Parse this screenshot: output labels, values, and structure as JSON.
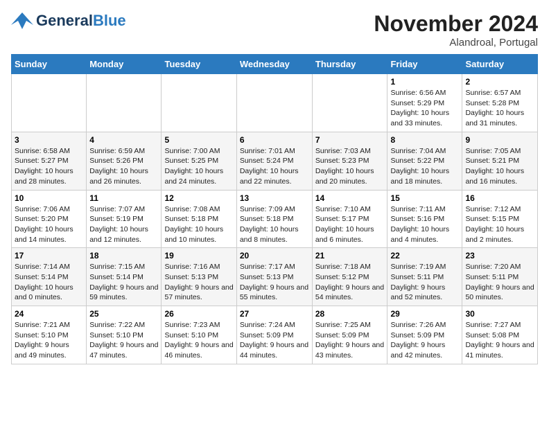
{
  "header": {
    "logo_general": "General",
    "logo_blue": "Blue",
    "month_title": "November 2024",
    "location": "Alandroal, Portugal"
  },
  "days_of_week": [
    "Sunday",
    "Monday",
    "Tuesday",
    "Wednesday",
    "Thursday",
    "Friday",
    "Saturday"
  ],
  "weeks": [
    [
      {
        "day": "",
        "sunrise": "",
        "sunset": "",
        "daylight": ""
      },
      {
        "day": "",
        "sunrise": "",
        "sunset": "",
        "daylight": ""
      },
      {
        "day": "",
        "sunrise": "",
        "sunset": "",
        "daylight": ""
      },
      {
        "day": "",
        "sunrise": "",
        "sunset": "",
        "daylight": ""
      },
      {
        "day": "",
        "sunrise": "",
        "sunset": "",
        "daylight": ""
      },
      {
        "day": "1",
        "sunrise": "Sunrise: 6:56 AM",
        "sunset": "Sunset: 5:29 PM",
        "daylight": "Daylight: 10 hours and 33 minutes."
      },
      {
        "day": "2",
        "sunrise": "Sunrise: 6:57 AM",
        "sunset": "Sunset: 5:28 PM",
        "daylight": "Daylight: 10 hours and 31 minutes."
      }
    ],
    [
      {
        "day": "3",
        "sunrise": "Sunrise: 6:58 AM",
        "sunset": "Sunset: 5:27 PM",
        "daylight": "Daylight: 10 hours and 28 minutes."
      },
      {
        "day": "4",
        "sunrise": "Sunrise: 6:59 AM",
        "sunset": "Sunset: 5:26 PM",
        "daylight": "Daylight: 10 hours and 26 minutes."
      },
      {
        "day": "5",
        "sunrise": "Sunrise: 7:00 AM",
        "sunset": "Sunset: 5:25 PM",
        "daylight": "Daylight: 10 hours and 24 minutes."
      },
      {
        "day": "6",
        "sunrise": "Sunrise: 7:01 AM",
        "sunset": "Sunset: 5:24 PM",
        "daylight": "Daylight: 10 hours and 22 minutes."
      },
      {
        "day": "7",
        "sunrise": "Sunrise: 7:03 AM",
        "sunset": "Sunset: 5:23 PM",
        "daylight": "Daylight: 10 hours and 20 minutes."
      },
      {
        "day": "8",
        "sunrise": "Sunrise: 7:04 AM",
        "sunset": "Sunset: 5:22 PM",
        "daylight": "Daylight: 10 hours and 18 minutes."
      },
      {
        "day": "9",
        "sunrise": "Sunrise: 7:05 AM",
        "sunset": "Sunset: 5:21 PM",
        "daylight": "Daylight: 10 hours and 16 minutes."
      }
    ],
    [
      {
        "day": "10",
        "sunrise": "Sunrise: 7:06 AM",
        "sunset": "Sunset: 5:20 PM",
        "daylight": "Daylight: 10 hours and 14 minutes."
      },
      {
        "day": "11",
        "sunrise": "Sunrise: 7:07 AM",
        "sunset": "Sunset: 5:19 PM",
        "daylight": "Daylight: 10 hours and 12 minutes."
      },
      {
        "day": "12",
        "sunrise": "Sunrise: 7:08 AM",
        "sunset": "Sunset: 5:18 PM",
        "daylight": "Daylight: 10 hours and 10 minutes."
      },
      {
        "day": "13",
        "sunrise": "Sunrise: 7:09 AM",
        "sunset": "Sunset: 5:18 PM",
        "daylight": "Daylight: 10 hours and 8 minutes."
      },
      {
        "day": "14",
        "sunrise": "Sunrise: 7:10 AM",
        "sunset": "Sunset: 5:17 PM",
        "daylight": "Daylight: 10 hours and 6 minutes."
      },
      {
        "day": "15",
        "sunrise": "Sunrise: 7:11 AM",
        "sunset": "Sunset: 5:16 PM",
        "daylight": "Daylight: 10 hours and 4 minutes."
      },
      {
        "day": "16",
        "sunrise": "Sunrise: 7:12 AM",
        "sunset": "Sunset: 5:15 PM",
        "daylight": "Daylight: 10 hours and 2 minutes."
      }
    ],
    [
      {
        "day": "17",
        "sunrise": "Sunrise: 7:14 AM",
        "sunset": "Sunset: 5:14 PM",
        "daylight": "Daylight: 10 hours and 0 minutes."
      },
      {
        "day": "18",
        "sunrise": "Sunrise: 7:15 AM",
        "sunset": "Sunset: 5:14 PM",
        "daylight": "Daylight: 9 hours and 59 minutes."
      },
      {
        "day": "19",
        "sunrise": "Sunrise: 7:16 AM",
        "sunset": "Sunset: 5:13 PM",
        "daylight": "Daylight: 9 hours and 57 minutes."
      },
      {
        "day": "20",
        "sunrise": "Sunrise: 7:17 AM",
        "sunset": "Sunset: 5:13 PM",
        "daylight": "Daylight: 9 hours and 55 minutes."
      },
      {
        "day": "21",
        "sunrise": "Sunrise: 7:18 AM",
        "sunset": "Sunset: 5:12 PM",
        "daylight": "Daylight: 9 hours and 54 minutes."
      },
      {
        "day": "22",
        "sunrise": "Sunrise: 7:19 AM",
        "sunset": "Sunset: 5:11 PM",
        "daylight": "Daylight: 9 hours and 52 minutes."
      },
      {
        "day": "23",
        "sunrise": "Sunrise: 7:20 AM",
        "sunset": "Sunset: 5:11 PM",
        "daylight": "Daylight: 9 hours and 50 minutes."
      }
    ],
    [
      {
        "day": "24",
        "sunrise": "Sunrise: 7:21 AM",
        "sunset": "Sunset: 5:10 PM",
        "daylight": "Daylight: 9 hours and 49 minutes."
      },
      {
        "day": "25",
        "sunrise": "Sunrise: 7:22 AM",
        "sunset": "Sunset: 5:10 PM",
        "daylight": "Daylight: 9 hours and 47 minutes."
      },
      {
        "day": "26",
        "sunrise": "Sunrise: 7:23 AM",
        "sunset": "Sunset: 5:10 PM",
        "daylight": "Daylight: 9 hours and 46 minutes."
      },
      {
        "day": "27",
        "sunrise": "Sunrise: 7:24 AM",
        "sunset": "Sunset: 5:09 PM",
        "daylight": "Daylight: 9 hours and 44 minutes."
      },
      {
        "day": "28",
        "sunrise": "Sunrise: 7:25 AM",
        "sunset": "Sunset: 5:09 PM",
        "daylight": "Daylight: 9 hours and 43 minutes."
      },
      {
        "day": "29",
        "sunrise": "Sunrise: 7:26 AM",
        "sunset": "Sunset: 5:09 PM",
        "daylight": "Daylight: 9 hours and 42 minutes."
      },
      {
        "day": "30",
        "sunrise": "Sunrise: 7:27 AM",
        "sunset": "Sunset: 5:08 PM",
        "daylight": "Daylight: 9 hours and 41 minutes."
      }
    ]
  ]
}
